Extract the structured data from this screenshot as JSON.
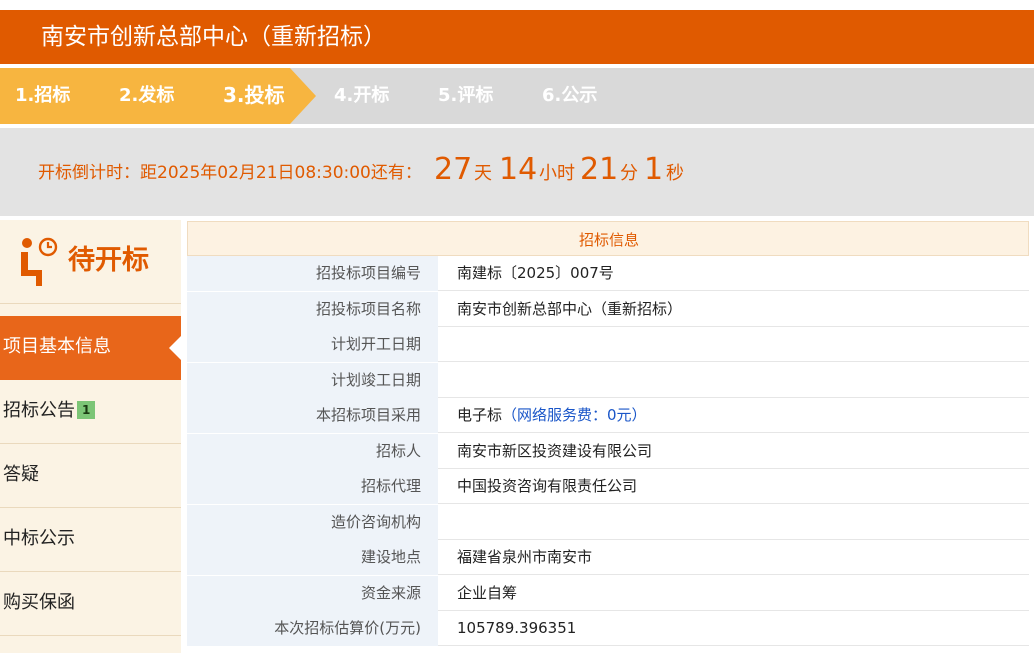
{
  "page_title": "南安市创新总部中心（重新招标）",
  "steps": [
    "1.招标",
    "2.发标",
    "3.投标",
    "4.开标",
    "5.评标",
    "6.公示"
  ],
  "current_step_index": 2,
  "countdown": {
    "prefix": "开标倒计时：距2025年02月21日08:30:00还有：",
    "days": "27",
    "days_unit": "天",
    "hours": "14",
    "hours_unit": "小时",
    "minutes": "21",
    "minutes_unit": "分",
    "seconds": "1",
    "seconds_unit": "秒"
  },
  "status": {
    "label": "待开标",
    "icon": "waiting-seat-icon"
  },
  "sidebar": {
    "items": [
      {
        "label": "项目基本信息",
        "active": true
      },
      {
        "label": "招标公告",
        "badge": "1"
      },
      {
        "label": "答疑"
      },
      {
        "label": "中标公示"
      },
      {
        "label": "购买保函"
      }
    ]
  },
  "info": {
    "header": "招标信息",
    "rows": [
      {
        "key": "招投标项目编号",
        "value": "南建标〔2025〕007号"
      },
      {
        "key": "招投标项目名称",
        "value": "南安市创新总部中心（重新招标）"
      },
      {
        "key": "计划开工日期",
        "value": ""
      },
      {
        "key": "计划竣工日期",
        "value": ""
      },
      {
        "key": "本招标项目采用",
        "value": "电子标",
        "note": "（网络服务费：0元）"
      },
      {
        "key": "招标人",
        "value": "南安市新区投资建设有限公司"
      },
      {
        "key": "招标代理",
        "value": "中国投资咨询有限责任公司"
      },
      {
        "key": "造价咨询机构",
        "value": ""
      },
      {
        "key": "建设地点",
        "value": "福建省泉州市南安市"
      },
      {
        "key": "资金来源",
        "value": "企业自筹"
      },
      {
        "key": "本次招标估算价(万元)",
        "value": "105789.396351"
      }
    ]
  },
  "colors": {
    "brand_orange": "#e05a00",
    "step_done": "#f7b540",
    "link_blue": "#1a56c8"
  }
}
